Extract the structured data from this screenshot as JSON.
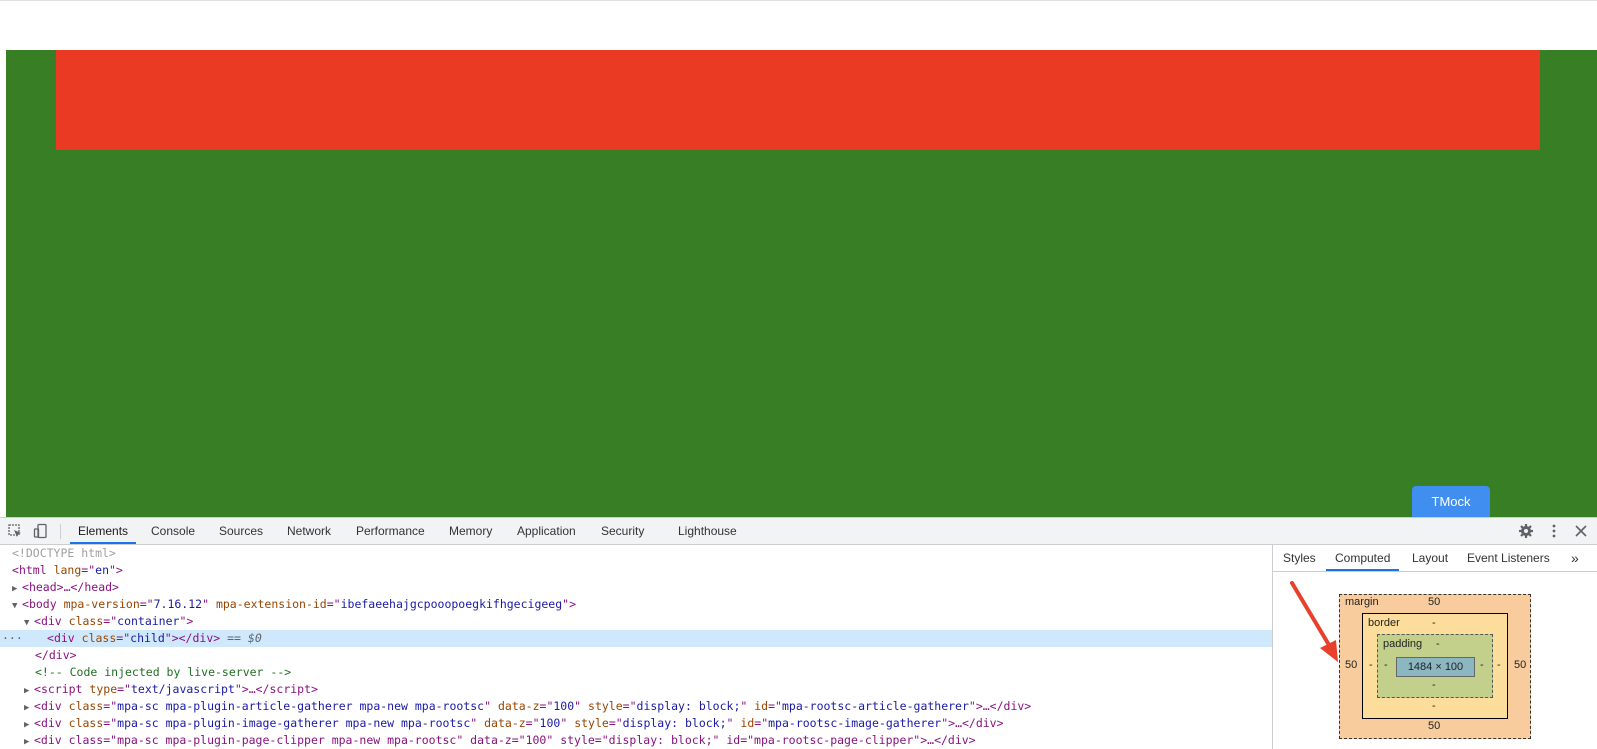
{
  "page": {
    "tmock_label": "TMock"
  },
  "devtools": {
    "tabs": [
      "Elements",
      "Console",
      "Sources",
      "Network",
      "Performance",
      "Memory",
      "Application",
      "Security",
      "Lighthouse"
    ],
    "active_tab": "Elements",
    "icons": {
      "inspect": "inspect-element-icon",
      "device": "device-toolbar-icon",
      "settings": "gear-icon",
      "more": "kebab-menu-icon",
      "close": "close-icon"
    },
    "dom": {
      "doctype": "<!DOCTYPE html>",
      "html_tag": "html",
      "html_attr": "lang",
      "html_val": "en",
      "head_text": "head",
      "body_tag": "body",
      "body_attr1": "mpa-version",
      "body_val1": "7.16.12",
      "body_attr2": "mpa-extension-id",
      "body_val2": "ibefaeehajgcpooopoegkifhgecigeeg",
      "container_tag": "div",
      "container_attr": "class",
      "container_val": "container",
      "child_tag": "div",
      "child_attr": "class",
      "child_val": "child",
      "selected_marker": "== $0",
      "close_div": "</div>",
      "comment": "<!-- Code injected by live-server -->",
      "script_tag": "script",
      "script_attr": "type",
      "script_val": "text/javascript",
      "mpa_rows": [
        {
          "cls": "mpa-sc mpa-plugin-article-gatherer mpa-new mpa-rootsc",
          "z": "100",
          "style": "display: block;",
          "id": "mpa-rootsc-article-gatherer"
        },
        {
          "cls": "mpa-sc mpa-plugin-image-gatherer mpa-new mpa-rootsc",
          "z": "100",
          "style": "display: block;",
          "id": "mpa-rootsc-image-gatherer"
        }
      ],
      "partial_row": "<div class=\"mpa-sc mpa-plugin-page-clipper mpa-new mpa-rootsc\" data-z=\"100\" style=\"display: block;\" id=\"mpa-rootsc-page-clipper\">…</div>"
    },
    "side_tabs": [
      "Styles",
      "Computed",
      "Layout",
      "Event Listeners"
    ],
    "side_active": "Computed",
    "box_model": {
      "margin_label": "margin",
      "margin_top": "50",
      "margin_right": "50",
      "margin_bottom": "50",
      "margin_left": "50",
      "border_label": "border",
      "border_top": "-",
      "border_right": "-",
      "border_bottom": "-",
      "border_left": "-",
      "padding_label": "padding",
      "padding_top": "-",
      "padding_right": "-",
      "padding_bottom": "-",
      "padding_left": "-",
      "content_size": "1484 × 100"
    },
    "colors": {
      "container": "#387e25",
      "child": "#ea3a24",
      "tmock": "#3f8ef0",
      "annotation_arrow": "#e8402b"
    }
  }
}
